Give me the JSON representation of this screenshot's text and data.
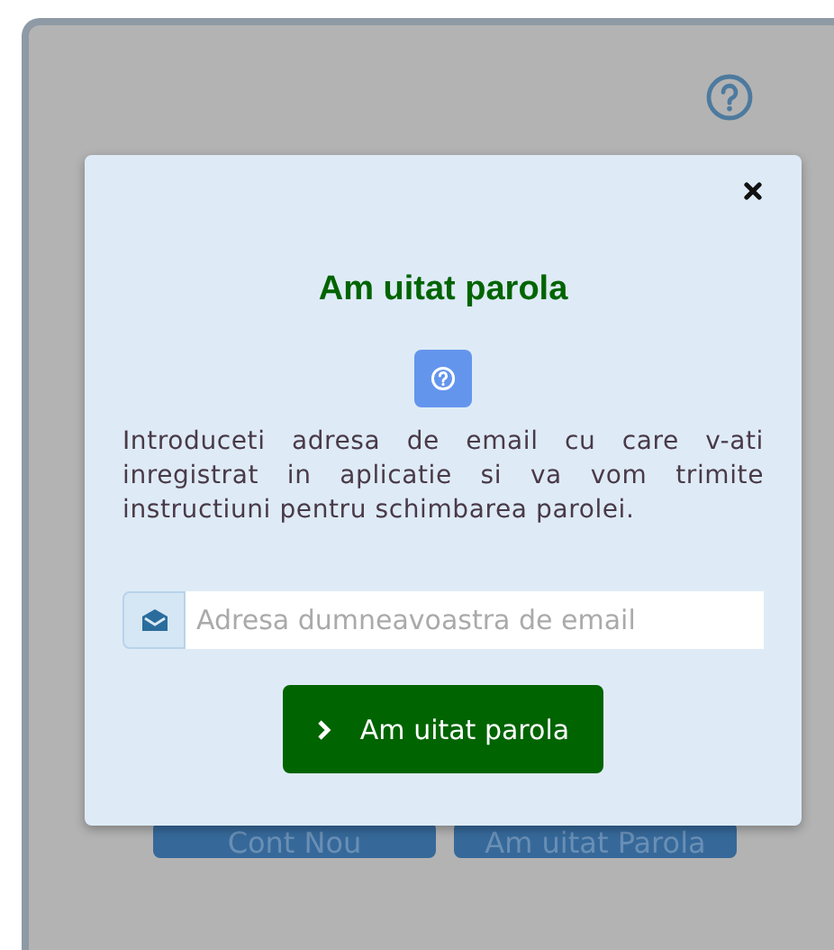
{
  "background": {
    "buttons": [
      {
        "label": "Cont Nou"
      },
      {
        "label": "Am uitat Parola"
      }
    ]
  },
  "modal": {
    "title": "Am uitat parola",
    "message": "Introduceti adresa de email cu care v-ati inregistrat in aplicatie si va vom trimite instructiuni pentru schimbarea parolei.",
    "email": {
      "placeholder": "Adresa dumneavoastra de email"
    },
    "submit": {
      "label": "Am uitat parola"
    }
  }
}
